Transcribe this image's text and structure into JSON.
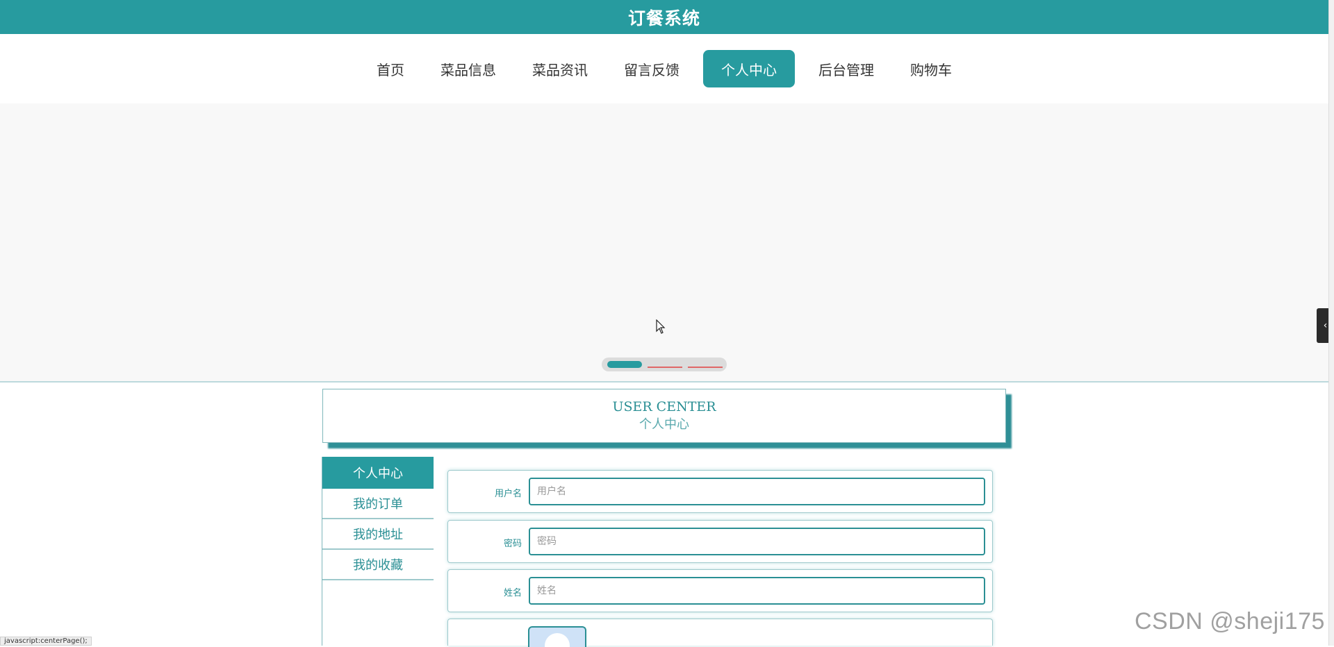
{
  "header": {
    "title": "订餐系统"
  },
  "nav": {
    "items": [
      {
        "label": "首页"
      },
      {
        "label": "菜品信息"
      },
      {
        "label": "菜品资讯"
      },
      {
        "label": "留言反馈"
      },
      {
        "label": "个人中心"
      },
      {
        "label": "后台管理"
      },
      {
        "label": "购物车"
      }
    ],
    "active_index": 4
  },
  "banner": {
    "active_slide": 1,
    "slide_count": 3
  },
  "section_title": {
    "en": "USER CENTER",
    "zh": "个人中心"
  },
  "side_menu": {
    "items": [
      {
        "label": "个人中心"
      },
      {
        "label": "我的订单"
      },
      {
        "label": "我的地址"
      },
      {
        "label": "我的收藏"
      }
    ],
    "active_index": 0
  },
  "form": {
    "username": {
      "label": "用户名",
      "placeholder": "用户名",
      "value": ""
    },
    "password": {
      "label": "密码",
      "placeholder": "密码",
      "value": ""
    },
    "name": {
      "label": "姓名",
      "placeholder": "姓名",
      "value": ""
    }
  },
  "status_bar": {
    "text": "javascript:centerPage();"
  },
  "watermark": {
    "text": "CSDN @sheji175"
  },
  "colors": {
    "accent": "#279b9f",
    "banner_bg": "#f8f8f8",
    "dot_idle": "#e06666"
  },
  "icons": {
    "side_handle": "chevron-left-icon",
    "cursor": "mouse-cursor-icon",
    "avatar": "avatar-placeholder-icon"
  }
}
